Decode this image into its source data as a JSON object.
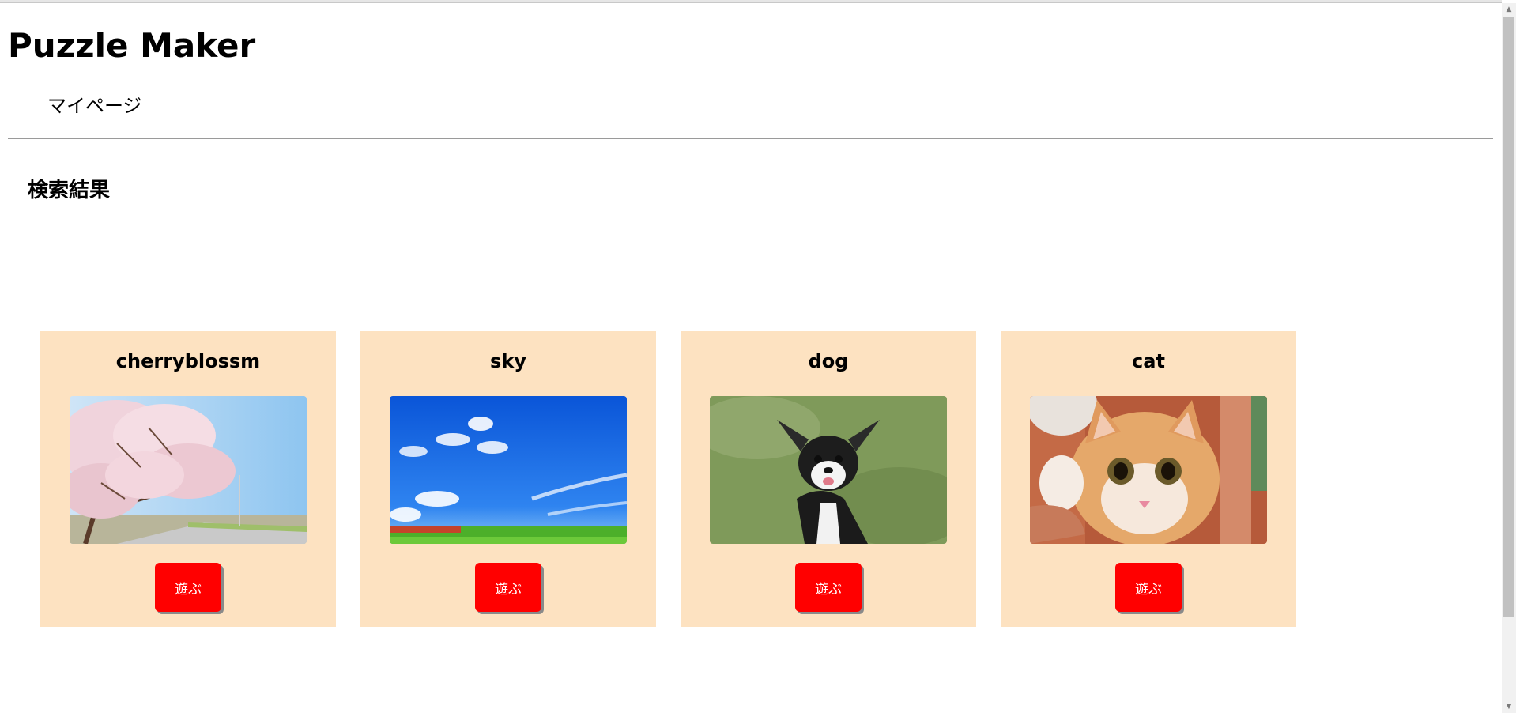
{
  "header": {
    "title": "Puzzle Maker",
    "nav_link": "マイページ"
  },
  "main": {
    "section_heading": "検索結果",
    "cards": [
      {
        "title": "cherryblossm",
        "image": "cherry-blossom-photo",
        "button_label": "遊ぶ"
      },
      {
        "title": "sky",
        "image": "blue-sky-photo",
        "button_label": "遊ぶ"
      },
      {
        "title": "dog",
        "image": "chihuahua-dog-photo",
        "button_label": "遊ぶ"
      },
      {
        "title": "cat",
        "image": "kitten-photo",
        "button_label": "遊ぶ"
      }
    ]
  },
  "colors": {
    "card_background": "#fde2c1",
    "button_background": "#ff0000",
    "button_text": "#ffffff"
  }
}
